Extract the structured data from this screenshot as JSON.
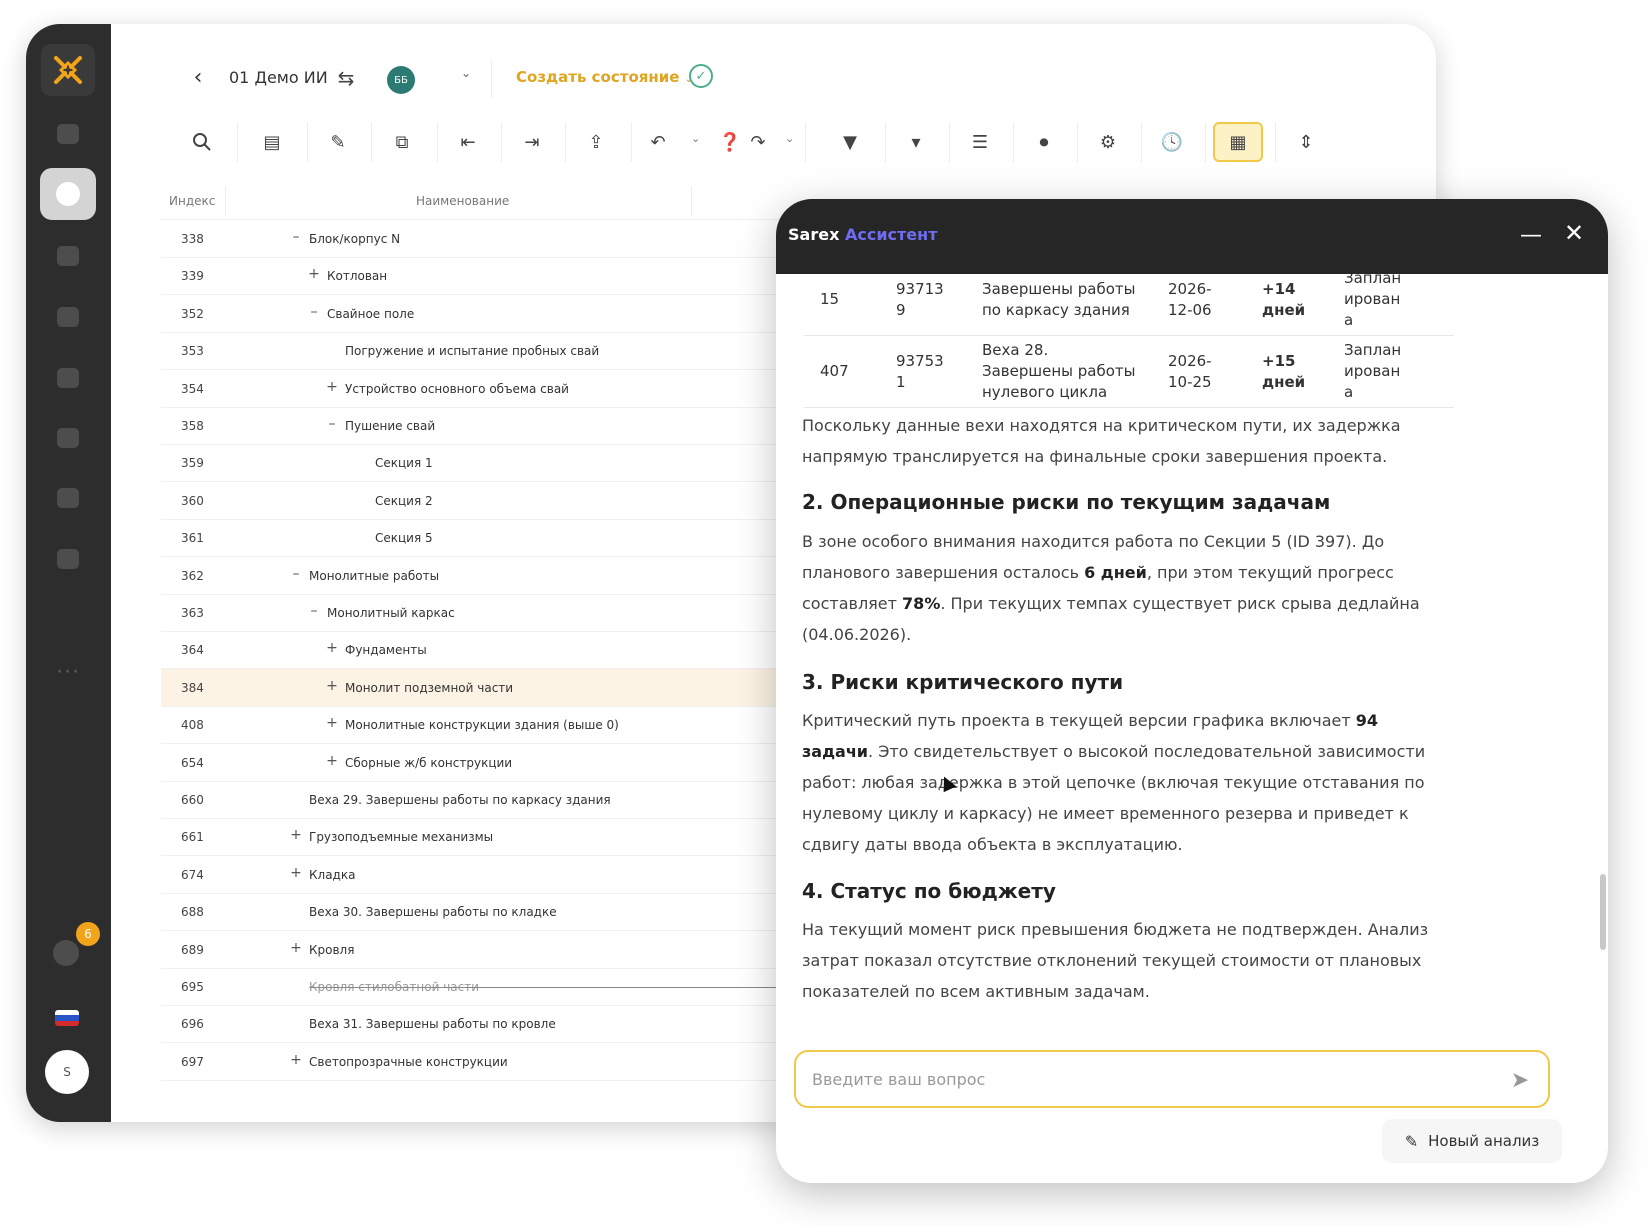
{
  "topbar": {
    "project_name": "01 Демо ИИ",
    "user_initials": "ББ",
    "create_state": "Создать состояние"
  },
  "rail": {
    "notifications_badge": "6",
    "user_initial": "S"
  },
  "table": {
    "columns": [
      "Индекс",
      "Наименование"
    ],
    "rows": [
      {
        "index": "338",
        "toggle": "–",
        "name": "Блок/корпус N",
        "level": 2
      },
      {
        "index": "339",
        "toggle": "+",
        "name": "Котлован",
        "level": 3
      },
      {
        "index": "352",
        "toggle": "–",
        "name": "Свайное поле",
        "level": 3
      },
      {
        "index": "353",
        "toggle": "",
        "name": "Погружение и испытание пробных свай",
        "level": 4
      },
      {
        "index": "354",
        "toggle": "+",
        "name": "Устройство основного объема свай",
        "level": 4
      },
      {
        "index": "358",
        "toggle": "–",
        "name": "Пушение свай",
        "level": 4
      },
      {
        "index": "359",
        "toggle": "",
        "name": "Секция 1",
        "level": 5
      },
      {
        "index": "360",
        "toggle": "",
        "name": "Секция 2",
        "level": 5
      },
      {
        "index": "361",
        "toggle": "",
        "name": "Секция 5",
        "level": 5
      },
      {
        "index": "362",
        "toggle": "–",
        "name": "Монолитные работы",
        "level": 2
      },
      {
        "index": "363",
        "toggle": "–",
        "name": "Монолитный каркас",
        "level": 3
      },
      {
        "index": "364",
        "toggle": "+",
        "name": "Фундаменты",
        "level": 4
      },
      {
        "index": "384",
        "toggle": "+",
        "name": "Монолит подземной части",
        "level": 4,
        "highlight": true
      },
      {
        "index": "408",
        "toggle": "+",
        "name": "Монолитные конструкции здания (выше 0)",
        "level": 4
      },
      {
        "index": "654",
        "toggle": "+",
        "name": "Сборные ж/б конструкции",
        "level": 4
      },
      {
        "index": "660",
        "toggle": "",
        "name": "Веха 29. Завершены работы по каркасу здания",
        "level": 2
      },
      {
        "index": "661",
        "toggle": "+",
        "name": "Грузоподъемные механизмы",
        "level": 2
      },
      {
        "index": "674",
        "toggle": "+",
        "name": "Кладка",
        "level": 2
      },
      {
        "index": "688",
        "toggle": "",
        "name": "Веха 30. Завершены работы по кладке",
        "level": 2
      },
      {
        "index": "689",
        "toggle": "+",
        "name": "Кровля",
        "level": 2
      },
      {
        "index": "695",
        "toggle": "",
        "name": "Кровля стилобатной части",
        "level": 2,
        "strike": true
      },
      {
        "index": "696",
        "toggle": "",
        "name": "Веха 31. Завершены работы по кровле",
        "level": 2
      },
      {
        "index": "697",
        "toggle": "+",
        "name": "Светопрозрачные конструкции",
        "level": 2
      }
    ]
  },
  "assistant": {
    "brand": "Sarex",
    "brand_accent": "Ассистент",
    "milestones": [
      {
        "n": "15",
        "id": "93713\n9",
        "name": "Завершены работы\nпо каркасу здания",
        "date": "2026-\n12-06",
        "delay": "+14\nдней",
        "status": "Заплан\nирован\nа"
      },
      {
        "n": "407",
        "id": "93753\n1",
        "name": "Веха 28.\nЗавершены работы\nнулевого цикла",
        "date": "2026-\n10-25",
        "delay": "+15\nдней",
        "status": "Заплан\nирован\nа"
      }
    ],
    "para_critical_path": "Поскольку данные вехи находятся на критическом пути, их задержка напрямую транслируется на финальные сроки завершения проекта.",
    "h_operational": "2. Операционные риски по текущим задачам",
    "op_text_1": "В зоне особого внимания находится работа по Секции 5 (ID 397). До планового завершения осталось ",
    "op_bold_1": "6 дней",
    "op_text_2": ", при этом текущий прогресс составляет ",
    "op_bold_2": "78%",
    "op_text_3": ". При текущих темпах существует риск срыва дедлайна (04.06.2026).",
    "h_critical": "3. Риски критического пути",
    "cp_text_1": "Критический путь проекта в текущей версии графика включает ",
    "cp_bold_1": "94 задачи",
    "cp_text_2": ". Это свидетельствует о высокой последовательной зависимости работ: любая задержка в этой цепочке (включая текущие отставания по нулевому циклу и каркасу) не имеет временного резерва и приведет к сдвигу даты ввода объекта в эксплуатацию.",
    "h_budget": "4. Статус по бюджету",
    "budget_text": "На текущий момент риск превышения бюджета не подтвержден. Анализ затрат показал отсутствие отклонений текущей стоимости от плановых показателей по всем активным задачам.",
    "input_placeholder": "Введите ваш вопрос",
    "new_analysis": "Новый анализ"
  },
  "colors": {
    "rail": "#2d2d2d",
    "accent_yellow": "#f0c84a",
    "create_state": "#e0a520",
    "assistant_header": "#262626",
    "brand_accent": "#6f6cf2",
    "row_highlight": "#fdf3e4"
  }
}
